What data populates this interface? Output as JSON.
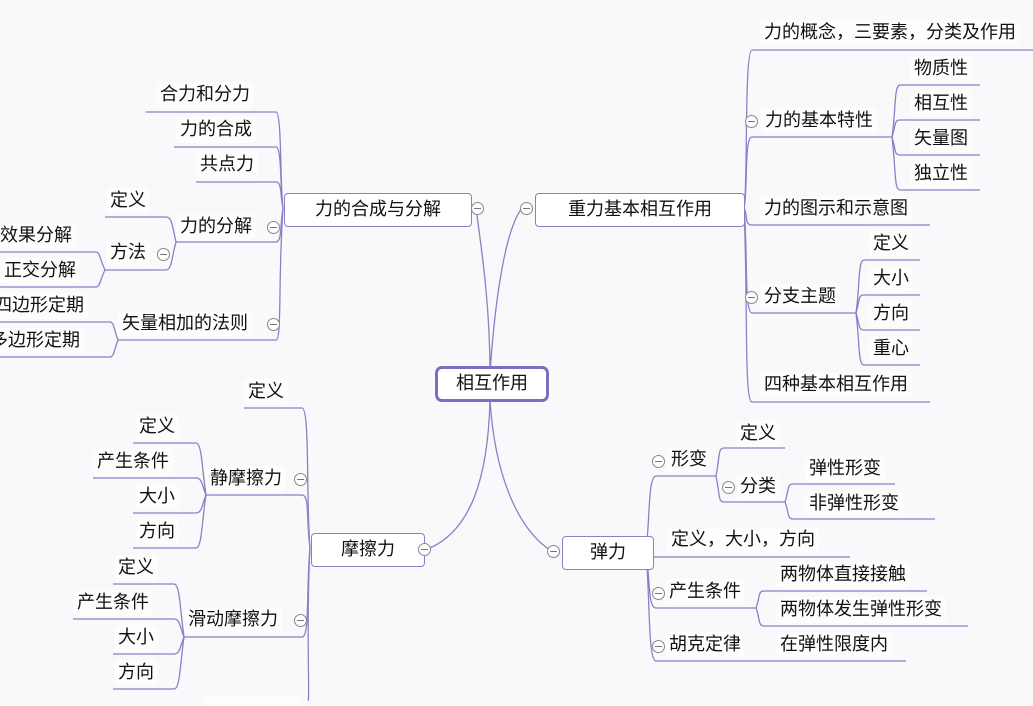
{
  "root": {
    "label": "相互作用"
  },
  "branches": {
    "composition": {
      "label": "力的合成与分解",
      "children": {
        "resultant": "合力和分力",
        "composition": "力的合成",
        "concurrent": "共点力",
        "decomposition": {
          "label": "力的分解",
          "definition": "定义",
          "method": {
            "label": "方法",
            "effect": "效果分解",
            "orthogonal": "正交分解"
          }
        },
        "vector_law": {
          "label": "矢量相加的法则",
          "parallelogram": "四边形定期",
          "polygon": "多边形定期"
        }
      }
    },
    "gravity": {
      "label": "重力基本相互作用",
      "children": {
        "concept": "力的概念，三要素，分类及作用",
        "properties": {
          "label": "力的基本特性",
          "items": [
            "物质性",
            "相互性",
            "矢量图",
            "独立性"
          ]
        },
        "diagram": "力的图示和示意图",
        "subtopic": {
          "label": "分支主题",
          "items": [
            "定义",
            "大小",
            "方向",
            "重心"
          ]
        },
        "four": "四种基本相互作用"
      }
    },
    "friction": {
      "label": "摩擦力",
      "children": {
        "definition": "定义",
        "static": {
          "label": "静摩擦力",
          "items": [
            "定义",
            "产生条件",
            "大小",
            "方向"
          ]
        },
        "sliding": {
          "label": "滑动摩擦力",
          "items": [
            "定义",
            "产生条件",
            "大小",
            "方向"
          ]
        }
      }
    },
    "elastic": {
      "label": "弹力",
      "children": {
        "deformation": {
          "label": "形变",
          "definition": "定义",
          "classification": {
            "label": "分类",
            "items": [
              "弹性形变",
              "非弹性形变"
            ]
          }
        },
        "def_size_dir": "定义，大小，方向",
        "conditions": {
          "label": "产生条件",
          "items": [
            "两物体直接接触",
            "两物体发生弹性形变"
          ]
        },
        "hooke": {
          "label": "胡克定律",
          "limit": "在弹性限度内"
        }
      }
    }
  },
  "colors": {
    "line": "#8a80c8",
    "root_border": "#7a70c0"
  }
}
